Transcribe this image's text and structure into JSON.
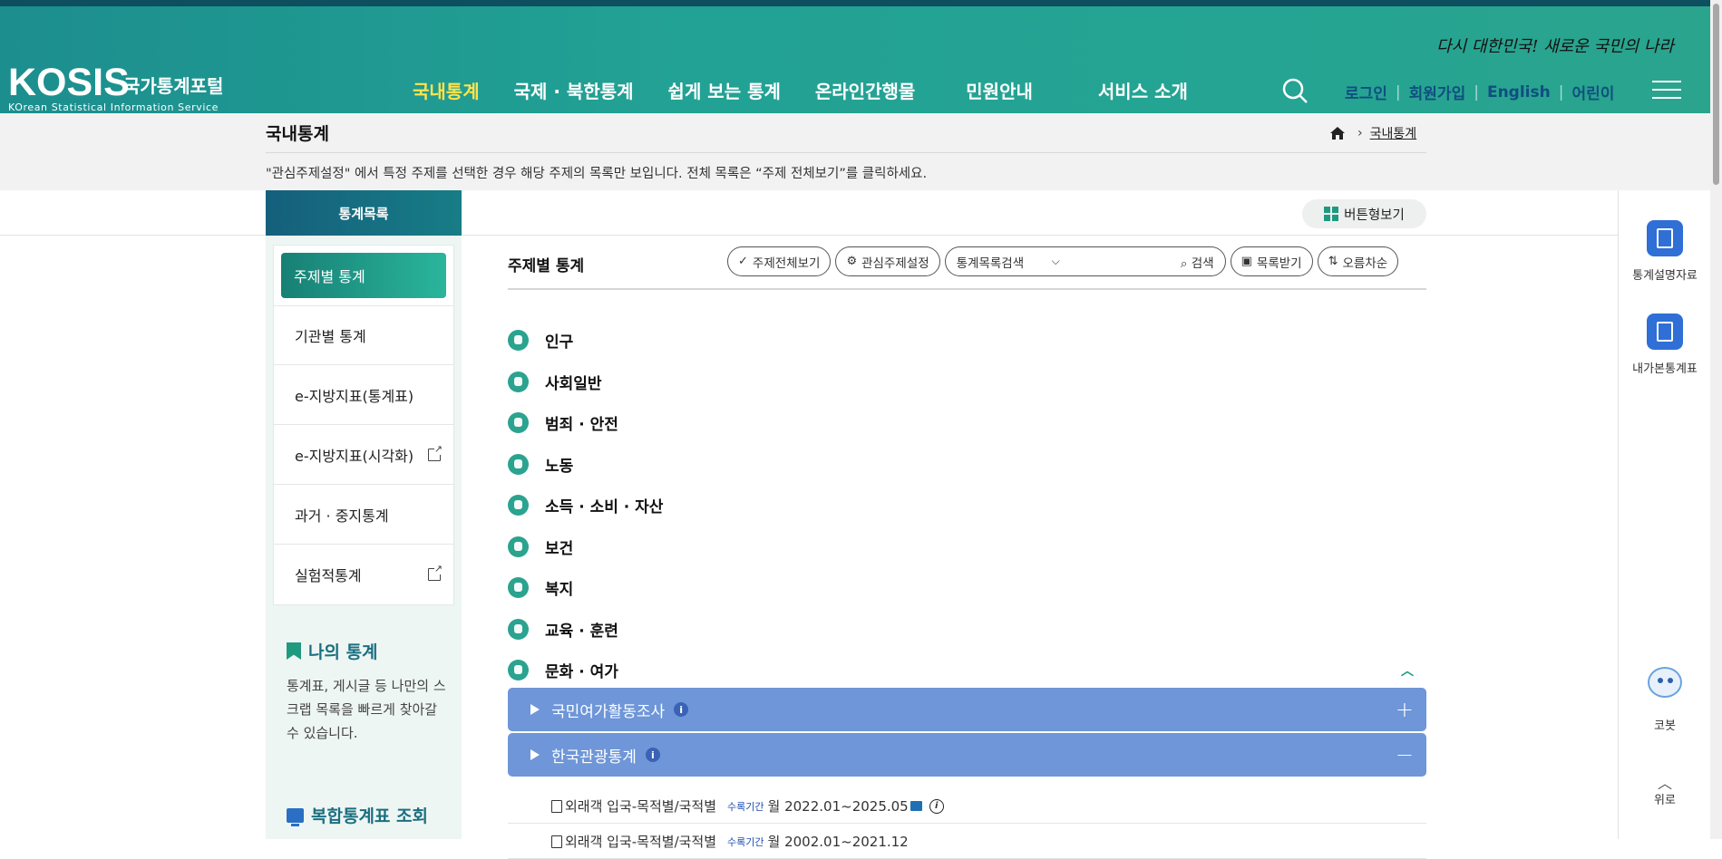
{
  "header": {
    "logo": "KOSIS",
    "logo_sub": "국가통계포털",
    "logo_eng": "KOrean Statistical Information Service",
    "slogan": "다시 대한민국! 새로운 국민의 나라",
    "nav": [
      "국내통계",
      "국제 · 북한통계",
      "쉽게 보는 통계",
      "온라인간행물",
      "민원안내",
      "서비스 소개"
    ],
    "util": [
      "로그인",
      "회원가입",
      "English",
      "어린이"
    ]
  },
  "page": {
    "title": "국내통계",
    "breadcrumb_current": "국내통계",
    "notice": "\"관심주제설정\" 에서 특정 주제를 선택한 경우 해당 주제의 목록만 보입니다. 전체 목록은 “주제 전체보기”를 클릭하세요."
  },
  "sidebar": {
    "head": "통계목록",
    "items": [
      "주제별 통계",
      "기관별 통계",
      "e-지방지표(통계표)",
      "e-지방지표(시각화)",
      "과거 · 중지통계",
      "실험적통계"
    ],
    "my_title": "나의 통계",
    "my_desc": "통계표, 게시글 등 나만의 스크랩 목록을 빠르게 찾아갈 수 있습니다.",
    "combo": "복합통계표 조회"
  },
  "content": {
    "view_button": "버튼형보기",
    "section_title": "주제별 통계",
    "toolbar": {
      "all": "주제전체보기",
      "interest": "관심주제설정",
      "search_select": "통계목록검색",
      "search_go": "검색",
      "download": "목록받기",
      "sort": "오름차순"
    },
    "categories": [
      "인구",
      "사회일반",
      "범죄 · 안전",
      "노동",
      "소득 · 소비 · 자산",
      "보건",
      "복지",
      "교육 · 훈련",
      "문화 · 여가"
    ],
    "bars": [
      {
        "label": "국민여가활동조사",
        "sign": "+"
      },
      {
        "label": "한국관광통계",
        "sign": "−"
      }
    ],
    "rows": [
      {
        "name": "외래객 입국-목적별/국적별",
        "tag": "수록기간",
        "period": "월 2022.01~2025.05"
      },
      {
        "name": "외래객 입국-목적별/국적별",
        "tag": "수록기간",
        "period": "월 2002.01~2021.12"
      }
    ]
  },
  "quick": {
    "items": [
      "통계설명자료",
      "내가본통계표",
      "코봇",
      "위로"
    ]
  }
}
